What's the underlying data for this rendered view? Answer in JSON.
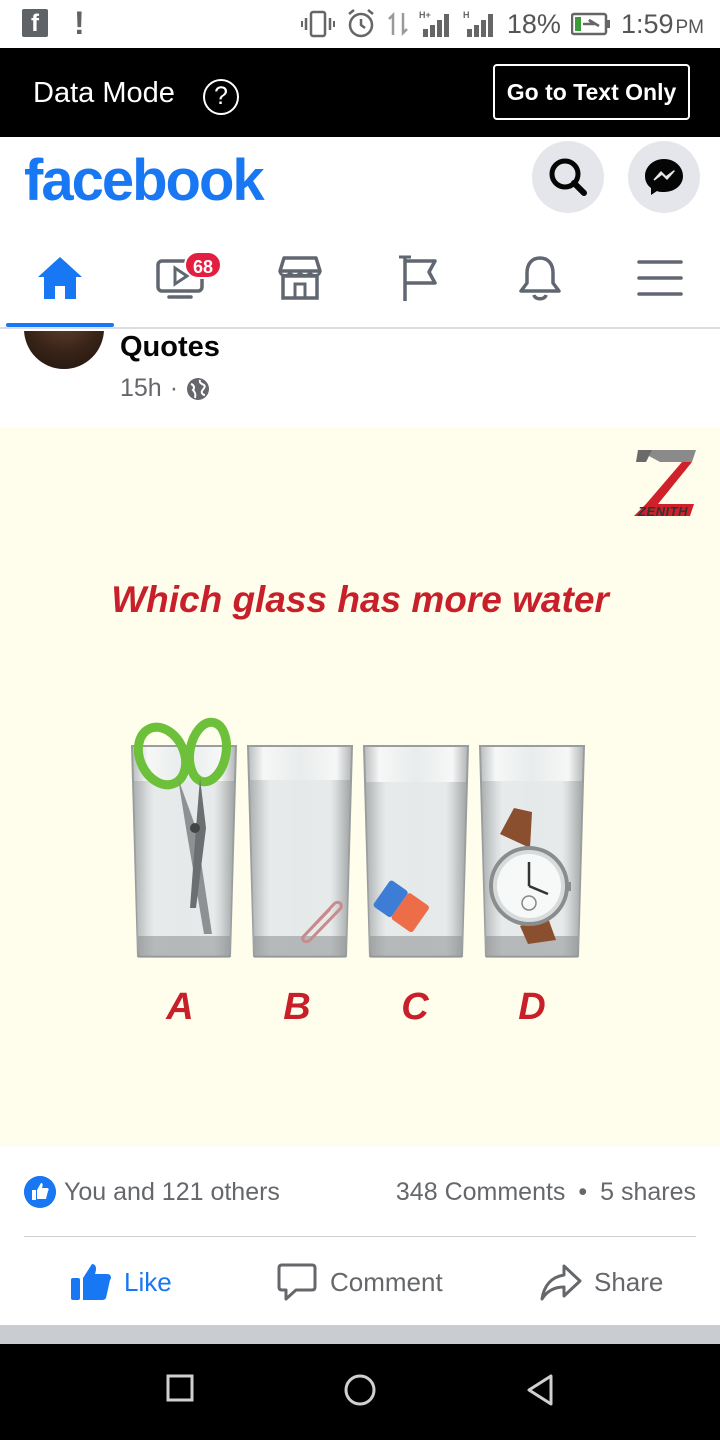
{
  "status_bar": {
    "battery": "18%",
    "time": "1:59",
    "ampm": "PM"
  },
  "data_mode_bar": {
    "title": "Data Mode",
    "help_glyph": "?",
    "text_only_button": "Go to Text Only"
  },
  "header": {
    "logo": "facebook",
    "brand_color": "#1877f2"
  },
  "nav": {
    "tabs": [
      {
        "icon": "home-icon",
        "active": true
      },
      {
        "icon": "watch-icon",
        "badge": "68"
      },
      {
        "icon": "marketplace-icon"
      },
      {
        "icon": "pages-flag-icon"
      },
      {
        "icon": "notifications-bell-icon"
      },
      {
        "icon": "menu-hamburger-icon"
      }
    ]
  },
  "post": {
    "author": "Quotes",
    "time": "15h",
    "separator": "·",
    "privacy_icon": "globe-icon",
    "image": {
      "brand": "ZENITH",
      "question": "Which glass has more water",
      "labels": [
        "A",
        "B",
        "C",
        "D"
      ],
      "objects": [
        "scissors",
        "paper clip",
        "eraser",
        "wrist watch"
      ],
      "text_color": "#c8202a",
      "background": "#fffdeb"
    },
    "reactions_text": "You and 121 others",
    "comments": "348 Comments",
    "dot": "•",
    "shares": "5 shares",
    "actions": {
      "like": "Like",
      "comment": "Comment",
      "share": "Share"
    }
  }
}
